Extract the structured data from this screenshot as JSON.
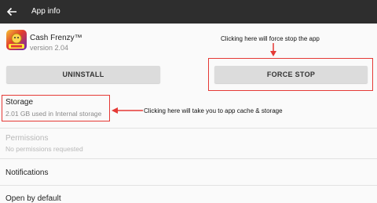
{
  "topbar": {
    "title": "App info"
  },
  "app": {
    "name": "Cash Frenzy™",
    "version": "version 2.04"
  },
  "buttons": {
    "uninstall": "UNINSTALL",
    "force_stop": "FORCE STOP"
  },
  "annotations": {
    "force_stop": "Clicking here will force stop the app",
    "storage": "Clicking here will take you to app cache & storage"
  },
  "rows": {
    "storage": {
      "title": "Storage",
      "subtitle": "2.01 GB used in Internal storage"
    },
    "permissions": {
      "title": "Permissions",
      "subtitle": "No permissions requested"
    },
    "notifications": {
      "title": "Notifications"
    },
    "open_by_default": {
      "title": "Open by default"
    }
  },
  "colors": {
    "annotation_red": "#e53935",
    "topbar": "#2e2e2e"
  },
  "icons": {
    "back": "arrow-back-icon",
    "app": "cash-frenzy-app-icon"
  }
}
